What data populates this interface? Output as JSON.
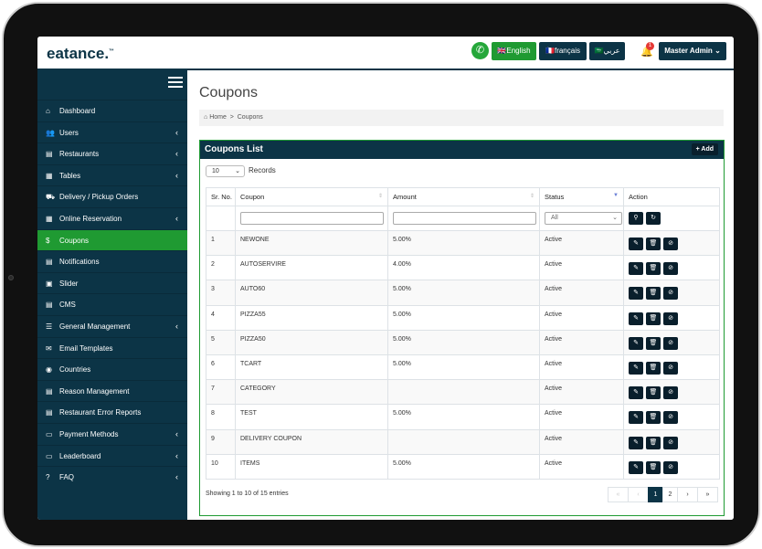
{
  "brand": {
    "name": "eatance.",
    "tm": "™"
  },
  "topbar": {
    "languages": [
      {
        "flag": "🇬🇧",
        "label": "English",
        "color": "#1f9a32"
      },
      {
        "flag": "🇫🇷",
        "label": "français",
        "color": "#0c3446"
      },
      {
        "flag": "🇸🇦",
        "label": "عربي",
        "color": "#0c3446"
      }
    ],
    "notification_count": "1",
    "user_label": "Master Admin"
  },
  "sidebar": {
    "items": [
      {
        "icon": "dashboard-icon",
        "glyph": "⌂",
        "label": "Dashboard",
        "chevron": false
      },
      {
        "icon": "users-icon",
        "glyph": "👥",
        "label": "Users",
        "chevron": true
      },
      {
        "icon": "file-icon",
        "glyph": "▤",
        "label": "Restaurants",
        "chevron": true
      },
      {
        "icon": "calendar-icon",
        "glyph": "▦",
        "label": "Tables",
        "chevron": true
      },
      {
        "icon": "cart-icon",
        "glyph": "⛟",
        "label": "Delivery / Pickup Orders",
        "chevron": false
      },
      {
        "icon": "calendar-icon",
        "glyph": "▦",
        "label": "Online Reservation",
        "chevron": true
      },
      {
        "icon": "dollar-icon",
        "glyph": "$",
        "label": "Coupons",
        "chevron": false,
        "active": true
      },
      {
        "icon": "file-icon",
        "glyph": "▤",
        "label": "Notifications",
        "chevron": false
      },
      {
        "icon": "image-icon",
        "glyph": "▣",
        "label": "Slider",
        "chevron": false
      },
      {
        "icon": "file-icon",
        "glyph": "▤",
        "label": "CMS",
        "chevron": false
      },
      {
        "icon": "sliders-icon",
        "glyph": "☰",
        "label": "General Management",
        "chevron": true
      },
      {
        "icon": "envelope-icon",
        "glyph": "✉",
        "label": "Email Templates",
        "chevron": false
      },
      {
        "icon": "globe-icon",
        "glyph": "◉",
        "label": "Countries",
        "chevron": false
      },
      {
        "icon": "file-icon",
        "glyph": "▤",
        "label": "Reason Management",
        "chevron": false
      },
      {
        "icon": "file-icon",
        "glyph": "▤",
        "label": "Restaurant Error Reports",
        "chevron": false
      },
      {
        "icon": "money-icon",
        "glyph": "▭",
        "label": "Payment Methods",
        "chevron": true
      },
      {
        "icon": "money-icon",
        "glyph": "▭",
        "label": "Leaderboard",
        "chevron": true
      },
      {
        "icon": "question-icon",
        "glyph": "?",
        "label": "FAQ",
        "chevron": true
      }
    ]
  },
  "page": {
    "title": "Coupons",
    "breadcrumb": {
      "home": "Home",
      "sep": ">",
      "current": "Coupons"
    }
  },
  "panel": {
    "title": "Coupons List",
    "add_label": "+ Add",
    "page_length": "10",
    "records_label": "Records",
    "columns": [
      "Sr. No.",
      "Coupon",
      "Amount",
      "Status",
      "Action"
    ],
    "status_filter": "All",
    "rows": [
      {
        "sr": "1",
        "coupon": "NEWONE",
        "amount": "5.00%",
        "status": "Active"
      },
      {
        "sr": "2",
        "coupon": "AUTOSERVIRE",
        "amount": "4.00%",
        "status": "Active"
      },
      {
        "sr": "3",
        "coupon": "AUTO60",
        "amount": "5.00%",
        "status": "Active"
      },
      {
        "sr": "4",
        "coupon": "PIZZA55",
        "amount": "5.00%",
        "status": "Active"
      },
      {
        "sr": "5",
        "coupon": "PIZZA50",
        "amount": "5.00%",
        "status": "Active"
      },
      {
        "sr": "6",
        "coupon": "TCART",
        "amount": "5.00%",
        "status": "Active"
      },
      {
        "sr": "7",
        "coupon": "CATEGORY",
        "amount": "",
        "status": "Active"
      },
      {
        "sr": "8",
        "coupon": "TEST",
        "amount": "5.00%",
        "status": "Active"
      },
      {
        "sr": "9",
        "coupon": "DELIVERY COUPON",
        "amount": "",
        "status": "Active"
      },
      {
        "sr": "10",
        "coupon": "ITEMS",
        "amount": "5.00%",
        "status": "Active"
      }
    ],
    "info": "Showing 1 to 10 of 15 entries",
    "pagination": [
      "«",
      "‹",
      "1",
      "2",
      "›",
      "»"
    ],
    "current_page": "1"
  }
}
